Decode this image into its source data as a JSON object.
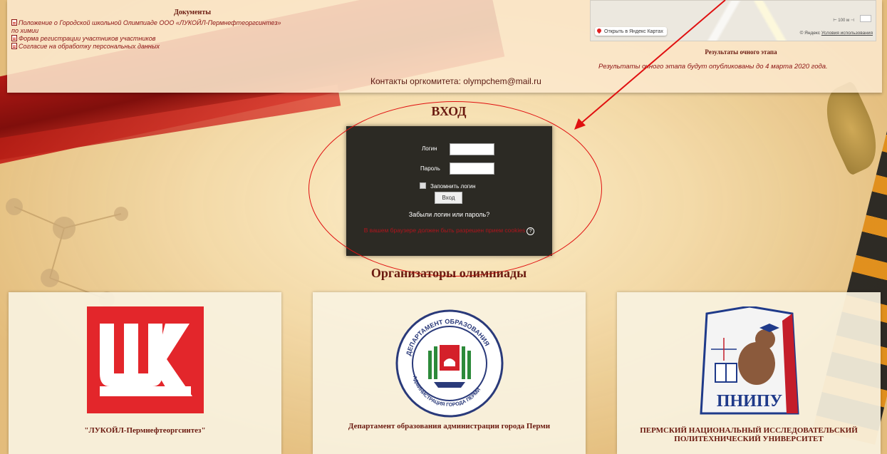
{
  "header": {
    "docs_title": "Документы",
    "docs": [
      {
        "label": "Положение о Городской школьной Олимпиаде ООО «ЛУКОЙЛ-Пермнефтеоргсинтез»"
      },
      {
        "label": "по химии"
      },
      {
        "label": "Форма регистрации участников участников"
      },
      {
        "label": "Согласие на обработку персональных данных"
      }
    ],
    "contacts": "Контакты оргкомитета: olympchem@mail.ru",
    "map": {
      "open_label": "Открыть в Яндекс Картах",
      "scale": "100 м",
      "copyright_prefix": "© Яндекс",
      "terms_link": "Условия использования"
    },
    "results_title": "Результаты очного этапа",
    "results_text": "Результаты очного этапа будут опубликованы до 4 марта 2020 года."
  },
  "login": {
    "heading": "ВХОД",
    "username_label": "Логин",
    "username_value": "",
    "password_label": "Пароль",
    "password_value": "",
    "remember_label": "Запомнить логин",
    "submit_label": "Вход",
    "forgot_label": "Забыли логин или пароль?",
    "cookie_warning": "В вашем браузере должен быть разрешен прием cookies"
  },
  "organizers": {
    "heading": "Организаторы олимпиады",
    "cards": [
      {
        "name": "\"ЛУКОЙЛ-Пермнефтеоргсинтез\""
      },
      {
        "name": "Департамент образования администрации города Перми"
      },
      {
        "name": "ПЕРМСКИЙ НАЦИОНАЛЬНЫЙ ИССЛЕДОВАТЕЛЬСКИЙ ПОЛИТЕХНИЧЕСКИЙ УНИВЕРСИТЕТ"
      }
    ],
    "logos": {
      "dept_top": "ДЕПАРТАМЕНТ ОБРАЗОВАНИЯ",
      "dept_bottom": "АДМИНИСТРАЦИЯ ГОРОДА ПЕРМИ",
      "pnipu": "ПНИПУ"
    }
  },
  "colors": {
    "heading": "#6b1a10",
    "link": "#8b1212",
    "annotation": "#e01010",
    "login_box": "#2c2a24"
  }
}
